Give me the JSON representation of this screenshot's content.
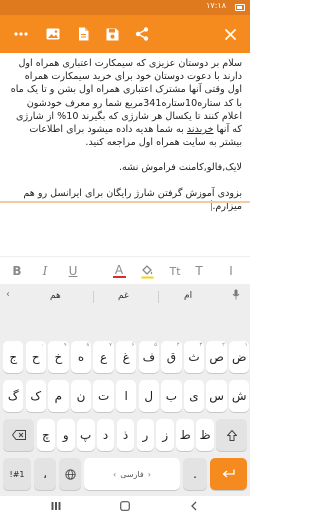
{
  "status": {
    "time": "۱۷:۱۸"
  },
  "toolbar": {
    "buttons": [
      "more-icon",
      "image-icon",
      "file-icon",
      "save-icon",
      "share-icon",
      "close-icon"
    ]
  },
  "editor": {
    "paragraphs": [
      [
        "سلام بر دوستان عزیزی که سیمکارت اعتباری همراه اول دارند با دعوت دوستان خود برای خرید سیمکارت همراه اول وقتی آنها مشترک اعتباری همراه اول بشن و تا یک ماه با کد ستاره10ستاره341مربع شما رو معرف خودشون اعلام کنند تا یکسال هر شارژی که بگیرند 10% از شارژی که آنها ",
        "خریدند",
        " به شما هدیه داده میشود برای اطلاعات بیشتر به سایت همراه اول مراجعه کنید."
      ],
      [
        "لایک,فالو,کامنت فراموش نشه."
      ],
      [
        "بزودی آموزش گرفتن شارژ رایگان برای ایرانسل رو هم میزارم."
      ]
    ]
  },
  "format_bar": {
    "items": [
      "B",
      "I",
      "U",
      "A",
      "fill",
      "Tt",
      "T",
      "I"
    ]
  },
  "keyboard": {
    "suggestions": [
      "هم",
      "غم",
      "ام"
    ],
    "rows": [
      [
        {
          "k": "ض",
          "h": "۱"
        },
        {
          "k": "ص",
          "h": "۲"
        },
        {
          "k": "ث",
          "h": "۳"
        },
        {
          "k": "ق",
          "h": "۴"
        },
        {
          "k": "ف",
          "h": "۵"
        },
        {
          "k": "غ",
          "h": "۶"
        },
        {
          "k": "ع",
          "h": "۷"
        },
        {
          "k": "ه",
          "h": "۸"
        },
        {
          "k": "خ",
          "h": "۹"
        },
        {
          "k": "ح",
          "h": "۰"
        },
        {
          "k": "ج",
          "h": ""
        }
      ],
      [
        {
          "k": "ش",
          "h": ""
        },
        {
          "k": "س",
          "h": ""
        },
        {
          "k": "ی",
          "h": ""
        },
        {
          "k": "ب",
          "h": ""
        },
        {
          "k": "ل",
          "h": ""
        },
        {
          "k": "ا",
          "h": ""
        },
        {
          "k": "ت",
          "h": ""
        },
        {
          "k": "ن",
          "h": ""
        },
        {
          "k": "م",
          "h": ""
        },
        {
          "k": "ک",
          "h": ""
        },
        {
          "k": "گ",
          "h": ""
        }
      ],
      [
        {
          "k": "ظ",
          "h": ""
        },
        {
          "k": "ط",
          "h": ""
        },
        {
          "k": "ز",
          "h": ""
        },
        {
          "k": "ر",
          "h": ""
        },
        {
          "k": "ذ",
          "h": ""
        },
        {
          "k": "د",
          "h": ""
        },
        {
          "k": "پ",
          "h": ""
        },
        {
          "k": "و",
          "h": ""
        },
        {
          "k": "چ",
          "h": ""
        }
      ]
    ],
    "bottom": {
      "symbols": "!#1",
      "comma": "،",
      "space": "فارسی",
      "period": "."
    }
  }
}
